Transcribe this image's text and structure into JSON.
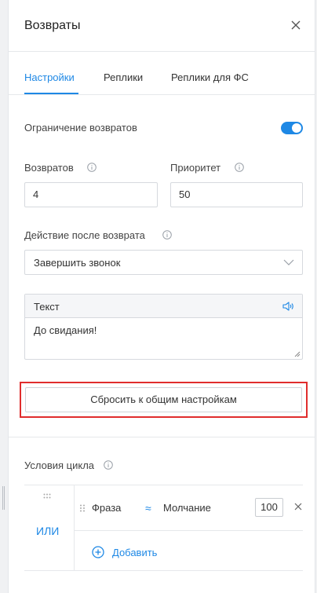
{
  "header": {
    "title": "Возвраты"
  },
  "tabs": [
    {
      "label": "Настройки"
    },
    {
      "label": "Реплики"
    },
    {
      "label": "Реплики для ФС"
    }
  ],
  "settings": {
    "limit_label": "Ограничение возвратов",
    "limit_enabled": true,
    "returns_label": "Возвратов",
    "returns_value": "4",
    "priority_label": "Приоритет",
    "priority_value": "50",
    "action_label": "Действие после возврата",
    "action_value": "Завершить звонок",
    "text_label": "Текст",
    "text_value": "До свидания!",
    "reset_label": "Сбросить к общим настройкам"
  },
  "cycle": {
    "title": "Условия цикла",
    "or_label": "ИЛИ",
    "conditions": [
      {
        "left": "Фраза",
        "operator": "≈",
        "right": "Молчание",
        "value": "100"
      }
    ],
    "add_label": "Добавить"
  },
  "colors": {
    "accent": "#1e88e5",
    "highlight_border": "#e02d2d"
  }
}
